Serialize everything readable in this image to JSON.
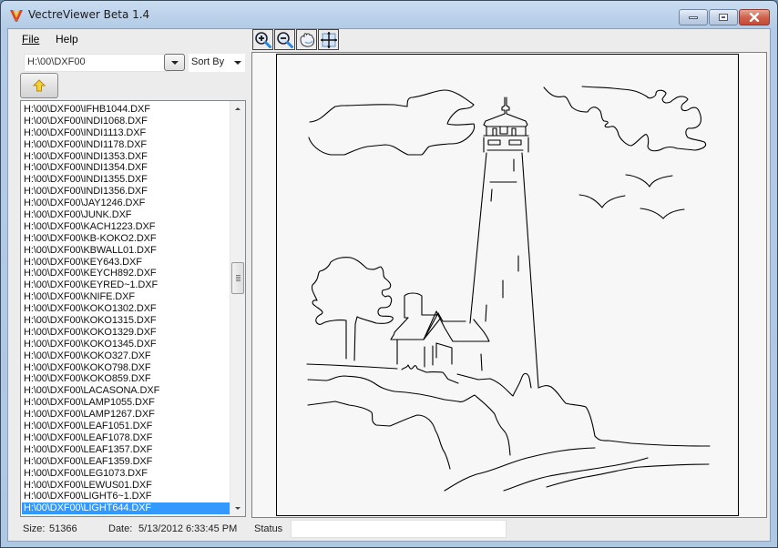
{
  "window": {
    "title": "VectreViewer Beta 1.4",
    "app_icon": "vectreviewer-logo-icon",
    "controls": [
      "minimize",
      "maximize",
      "close"
    ]
  },
  "menu": {
    "items": [
      {
        "label": "File",
        "accel": "F"
      },
      {
        "label": "Help",
        "accel": "H"
      }
    ]
  },
  "browser": {
    "path_value": "H:\\00\\DXF00",
    "sort_label": "Sort By",
    "up_button_icon": "up-arrow-icon",
    "files": [
      "H:\\00\\DXF00\\IFHB1044.DXF",
      "H:\\00\\DXF00\\INDI1068.DXF",
      "H:\\00\\DXF00\\INDI1113.DXF",
      "H:\\00\\DXF00\\INDI1178.DXF",
      "H:\\00\\DXF00\\INDI1353.DXF",
      "H:\\00\\DXF00\\INDI1354.DXF",
      "H:\\00\\DXF00\\INDI1355.DXF",
      "H:\\00\\DXF00\\INDI1356.DXF",
      "H:\\00\\DXF00\\JAY1246.DXF",
      "H:\\00\\DXF00\\JUNK.DXF",
      "H:\\00\\DXF00\\KACH1223.DXF",
      "H:\\00\\DXF00\\KB-KOKO2.DXF",
      "H:\\00\\DXF00\\KBWALL01.DXF",
      "H:\\00\\DXF00\\KEY643.DXF",
      "H:\\00\\DXF00\\KEYCH892.DXF",
      "H:\\00\\DXF00\\KEYRED~1.DXF",
      "H:\\00\\DXF00\\KNIFE.DXF",
      "H:\\00\\DXF00\\KOKO1302.DXF",
      "H:\\00\\DXF00\\KOKO1315.DXF",
      "H:\\00\\DXF00\\KOKO1329.DXF",
      "H:\\00\\DXF00\\KOKO1345.DXF",
      "H:\\00\\DXF00\\KOKO327.DXF",
      "H:\\00\\DXF00\\KOKO798.DXF",
      "H:\\00\\DXF00\\KOKO859.DXF",
      "H:\\00\\DXF00\\LACASONA.DXF",
      "H:\\00\\DXF00\\LAMP1055.DXF",
      "H:\\00\\DXF00\\LAMP1267.DXF",
      "H:\\00\\DXF00\\LEAF1051.DXF",
      "H:\\00\\DXF00\\LEAF1078.DXF",
      "H:\\00\\DXF00\\LEAF1357.DXF",
      "H:\\00\\DXF00\\LEAF1359.DXF",
      "H:\\00\\DXF00\\LEG1073.DXF",
      "H:\\00\\DXF00\\LEWUS01.DXF",
      "H:\\00\\DXF00\\LIGHT6~1.DXF",
      "H:\\00\\DXF00\\LIGHT644.DXF"
    ],
    "selected_index": 34
  },
  "info": {
    "size_label": "Size:",
    "size_value": "51366",
    "date_label": "Date:",
    "date_value": "5/13/2012 6:33:45 PM",
    "status_label": "Status",
    "status_value": ""
  },
  "toolbar": {
    "tools": [
      {
        "name": "zoom-in",
        "icon": "zoom-in-icon"
      },
      {
        "name": "zoom-out",
        "icon": "zoom-out-icon"
      },
      {
        "name": "pan",
        "icon": "hand-icon"
      },
      {
        "name": "fit",
        "icon": "fit-to-window-icon"
      }
    ]
  },
  "viewer": {
    "subject": "lighthouse line drawing",
    "colors": {
      "stroke": "#000000",
      "background": "#f7f7f7"
    }
  }
}
